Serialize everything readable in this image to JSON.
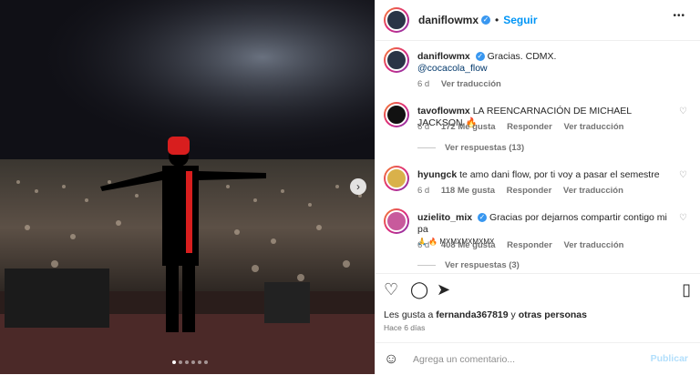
{
  "post": {
    "username": "daniflowmx",
    "follow_label": "Seguir",
    "separator": "•",
    "more_label": "•••"
  },
  "caption": {
    "username": "daniflowmx",
    "text": "Gracias. CDMX.",
    "mention": "@cocacola_flow",
    "age": "6 d",
    "translate": "Ver traducción"
  },
  "comments": [
    {
      "username": "tavoflowmx",
      "text": "LA REENCARNACIÓN DE MICHAEL JACKSON 🔥",
      "age": "6 d",
      "likes": "172 Me gusta",
      "reply": "Responder",
      "translate": "Ver traducción",
      "replies": "Ver respuestas (13)"
    },
    {
      "username": "hyungck",
      "text": "te amo dani flow, por ti voy a pasar el semestre",
      "age": "6 d",
      "likes": "118 Me gusta",
      "reply": "Responder",
      "translate": "Ver traducción"
    },
    {
      "username": "uzielito_mix",
      "text": "Gracias por dejarnos compartir contigo mi pa",
      "text2": "🙏 🔥 MXMXMXMXMX",
      "age": "6 d",
      "likes": "408 Me gusta",
      "reply": "Responder",
      "translate": "Ver traducción",
      "replies": "Ver respuestas (3)"
    }
  ],
  "likes": {
    "prefix": "Les gusta a ",
    "user": "fernanda367819",
    "mid": " y ",
    "others": "otras personas"
  },
  "timestamp": "Hace 6 días",
  "add_comment": {
    "placeholder": "Agrega un comentario...",
    "post_label": "Publicar"
  },
  "carousel": {
    "current": 1,
    "total": 6
  },
  "colors": {
    "accent": "#0095f6",
    "verified": "#3897f0",
    "stage_red": "#d81e1e"
  },
  "icons": [
    "heart-icon",
    "comment-icon",
    "share-icon",
    "bookmark-icon",
    "emoji-icon",
    "chevron-right-icon",
    "verified-icon",
    "more-icon"
  ]
}
